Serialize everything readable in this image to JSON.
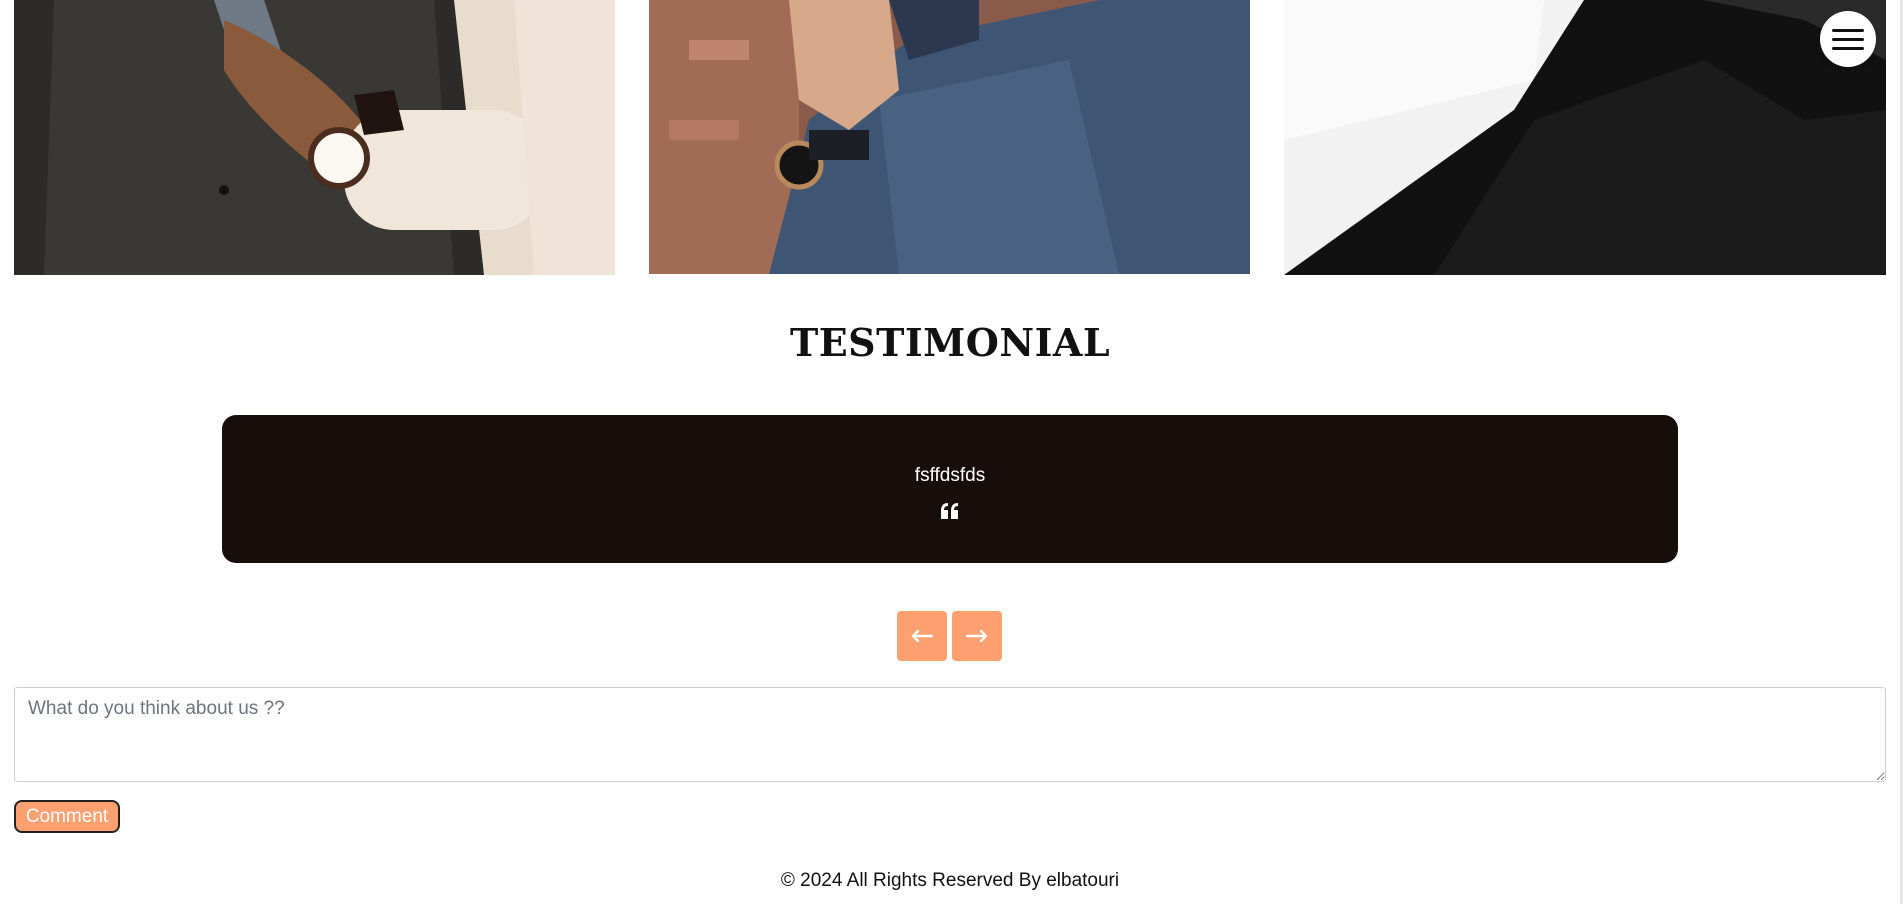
{
  "gallery": {
    "photos": [
      {
        "name": "suit-vest-watch-photo"
      },
      {
        "name": "denim-shirt-watch-photo"
      },
      {
        "name": "black-shirt-photo"
      }
    ]
  },
  "header": {
    "menu_icon": "hamburger-menu-icon"
  },
  "testimonial": {
    "title": "TESTIMONIAL",
    "quote": "fsffdsfds",
    "quote_icon": "quote-icon"
  },
  "carousel": {
    "prev_icon": "arrow-left-icon",
    "next_icon": "arrow-right-icon"
  },
  "comment_form": {
    "placeholder": "What do you think about us ??",
    "value": "",
    "button_label": "Comment"
  },
  "footer": {
    "copyright": "© 2024 All Rights Reserved By elbatouri"
  },
  "colors": {
    "accent": "#ffa070",
    "card_background": "#170e0b",
    "text": "#111111"
  }
}
